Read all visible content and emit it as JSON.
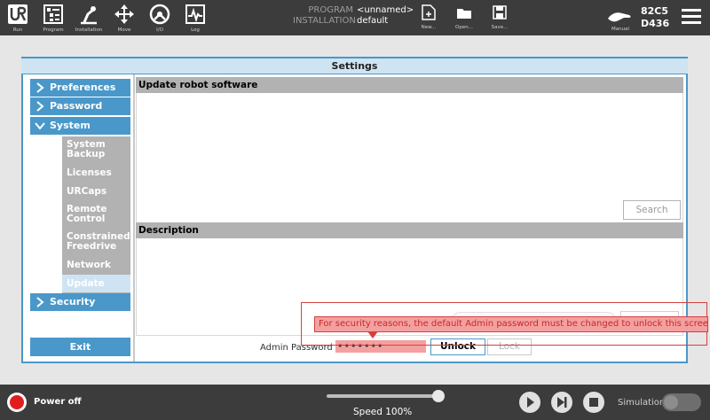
{
  "topbar": {
    "nav": [
      {
        "label": "Run",
        "icon": "ur-logo-icon"
      },
      {
        "label": "Program",
        "icon": "program-icon"
      },
      {
        "label": "Installation",
        "icon": "installation-icon"
      },
      {
        "label": "Move",
        "icon": "move-icon"
      },
      {
        "label": "I/O",
        "icon": "io-icon"
      },
      {
        "label": "Log",
        "icon": "log-icon"
      }
    ],
    "program_key": "PROGRAM",
    "program_value": "<unnamed>",
    "installation_key": "INSTALLATION",
    "installation_value": "default",
    "file_buttons": [
      {
        "label": "New...",
        "icon": "new-file-icon"
      },
      {
        "label": "Open...",
        "icon": "open-folder-icon"
      },
      {
        "label": "Save...",
        "icon": "save-icon"
      }
    ],
    "mode_label": "Manual",
    "serial_line1": "82C5",
    "serial_line2": "D436"
  },
  "settings": {
    "title": "Settings",
    "sidebar": {
      "preferences": "Preferences",
      "password": "Password",
      "system": "System",
      "sub_items": [
        "System Backup",
        "Licenses",
        "URCaps",
        "Remote Control",
        "Constrained Freedrive",
        "Network",
        "Update"
      ],
      "security": "Security",
      "exit": "Exit"
    },
    "content": {
      "update_header": "Update robot software",
      "search_label": "Search",
      "description_header": "Description",
      "admin_password_label": "Admin Password",
      "admin_password_value": "•••••••",
      "unlock_label": "Unlock",
      "lock_label": "Lock"
    },
    "tooltip": "For security reasons, the default Admin password must be changed to unlock this screen."
  },
  "bottombar": {
    "power_label": "Power off",
    "speed_label": "Speed 100%",
    "speed_value": 100,
    "simulation_label": "Simulation",
    "simulation_on": false
  },
  "colors": {
    "accent": "#4a98c9",
    "topbar_bg": "#3c3c3c",
    "sub_item_bg": "#b2b2b2",
    "active_item_bg": "#cfe4f3",
    "warning_bg": "#f4a0a0",
    "warning_border": "#d43f3f",
    "power_off": "#e01e1e"
  }
}
